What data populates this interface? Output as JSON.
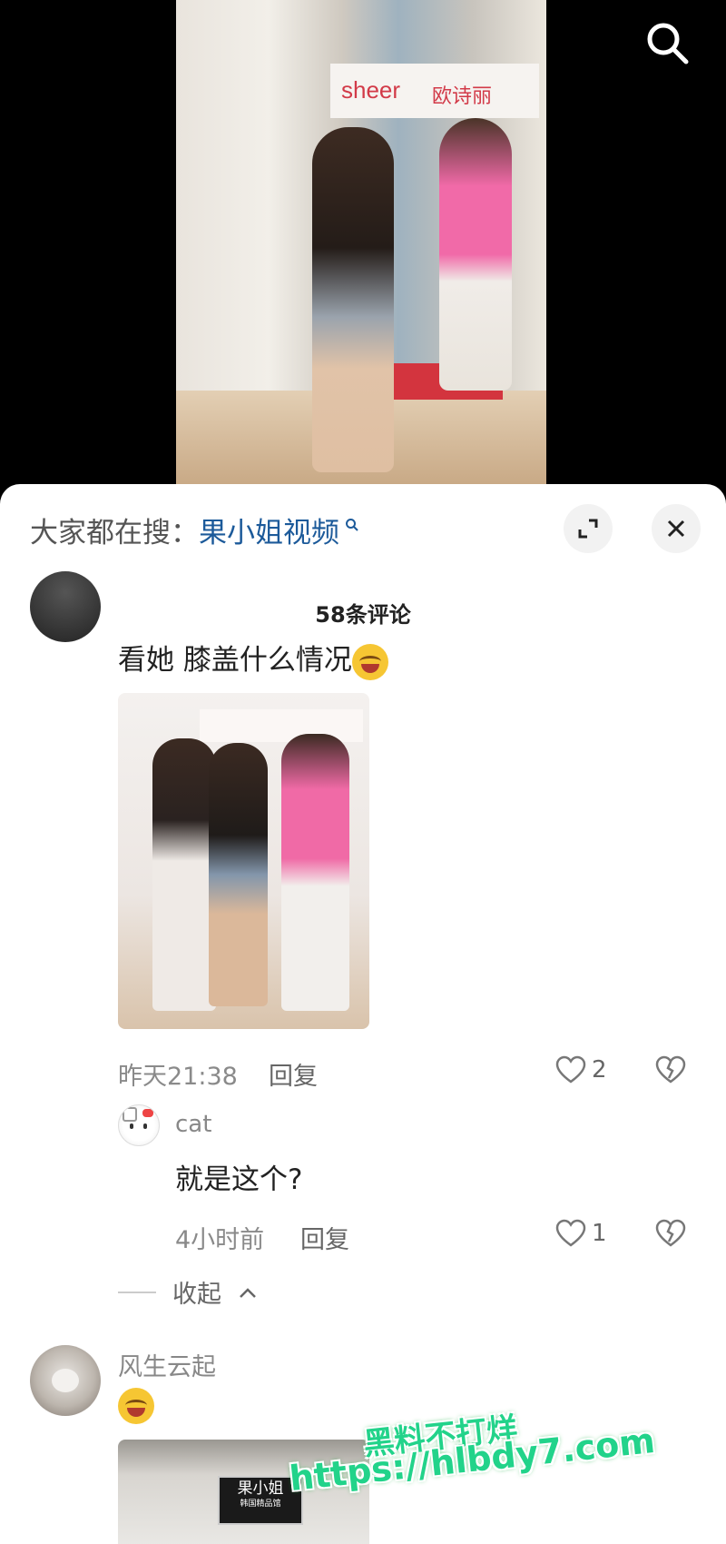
{
  "video": {
    "sign_text_1": "sheer",
    "sign_text_2": "欧诗丽",
    "search_icon": "search-icon"
  },
  "panel": {
    "hint_prefix": "大家都在搜：",
    "hint_keyword": "果小姐视频",
    "expand_icon": "expand-icon",
    "close_icon": "close-icon",
    "comment_count": "58条评论"
  },
  "comments": [
    {
      "text": "看她 膝盖什么情况",
      "time": "昨天21:38",
      "reply_label": "回复",
      "likes": "2",
      "replies": [
        {
          "username": "cat",
          "text": "就是这个?",
          "time": "4小时前",
          "reply_label": "回复",
          "likes": "1"
        }
      ],
      "collapse_label": "收起"
    },
    {
      "username": "风生云起",
      "store_sign": "果小姐",
      "store_sub": "韩国精品馆"
    }
  ],
  "watermark": {
    "line1": "黑料不打烊",
    "line2": "https://hlbdy7.com"
  },
  "colors": {
    "keyword": "#1c5a9a",
    "watermark": "#22d38a"
  }
}
